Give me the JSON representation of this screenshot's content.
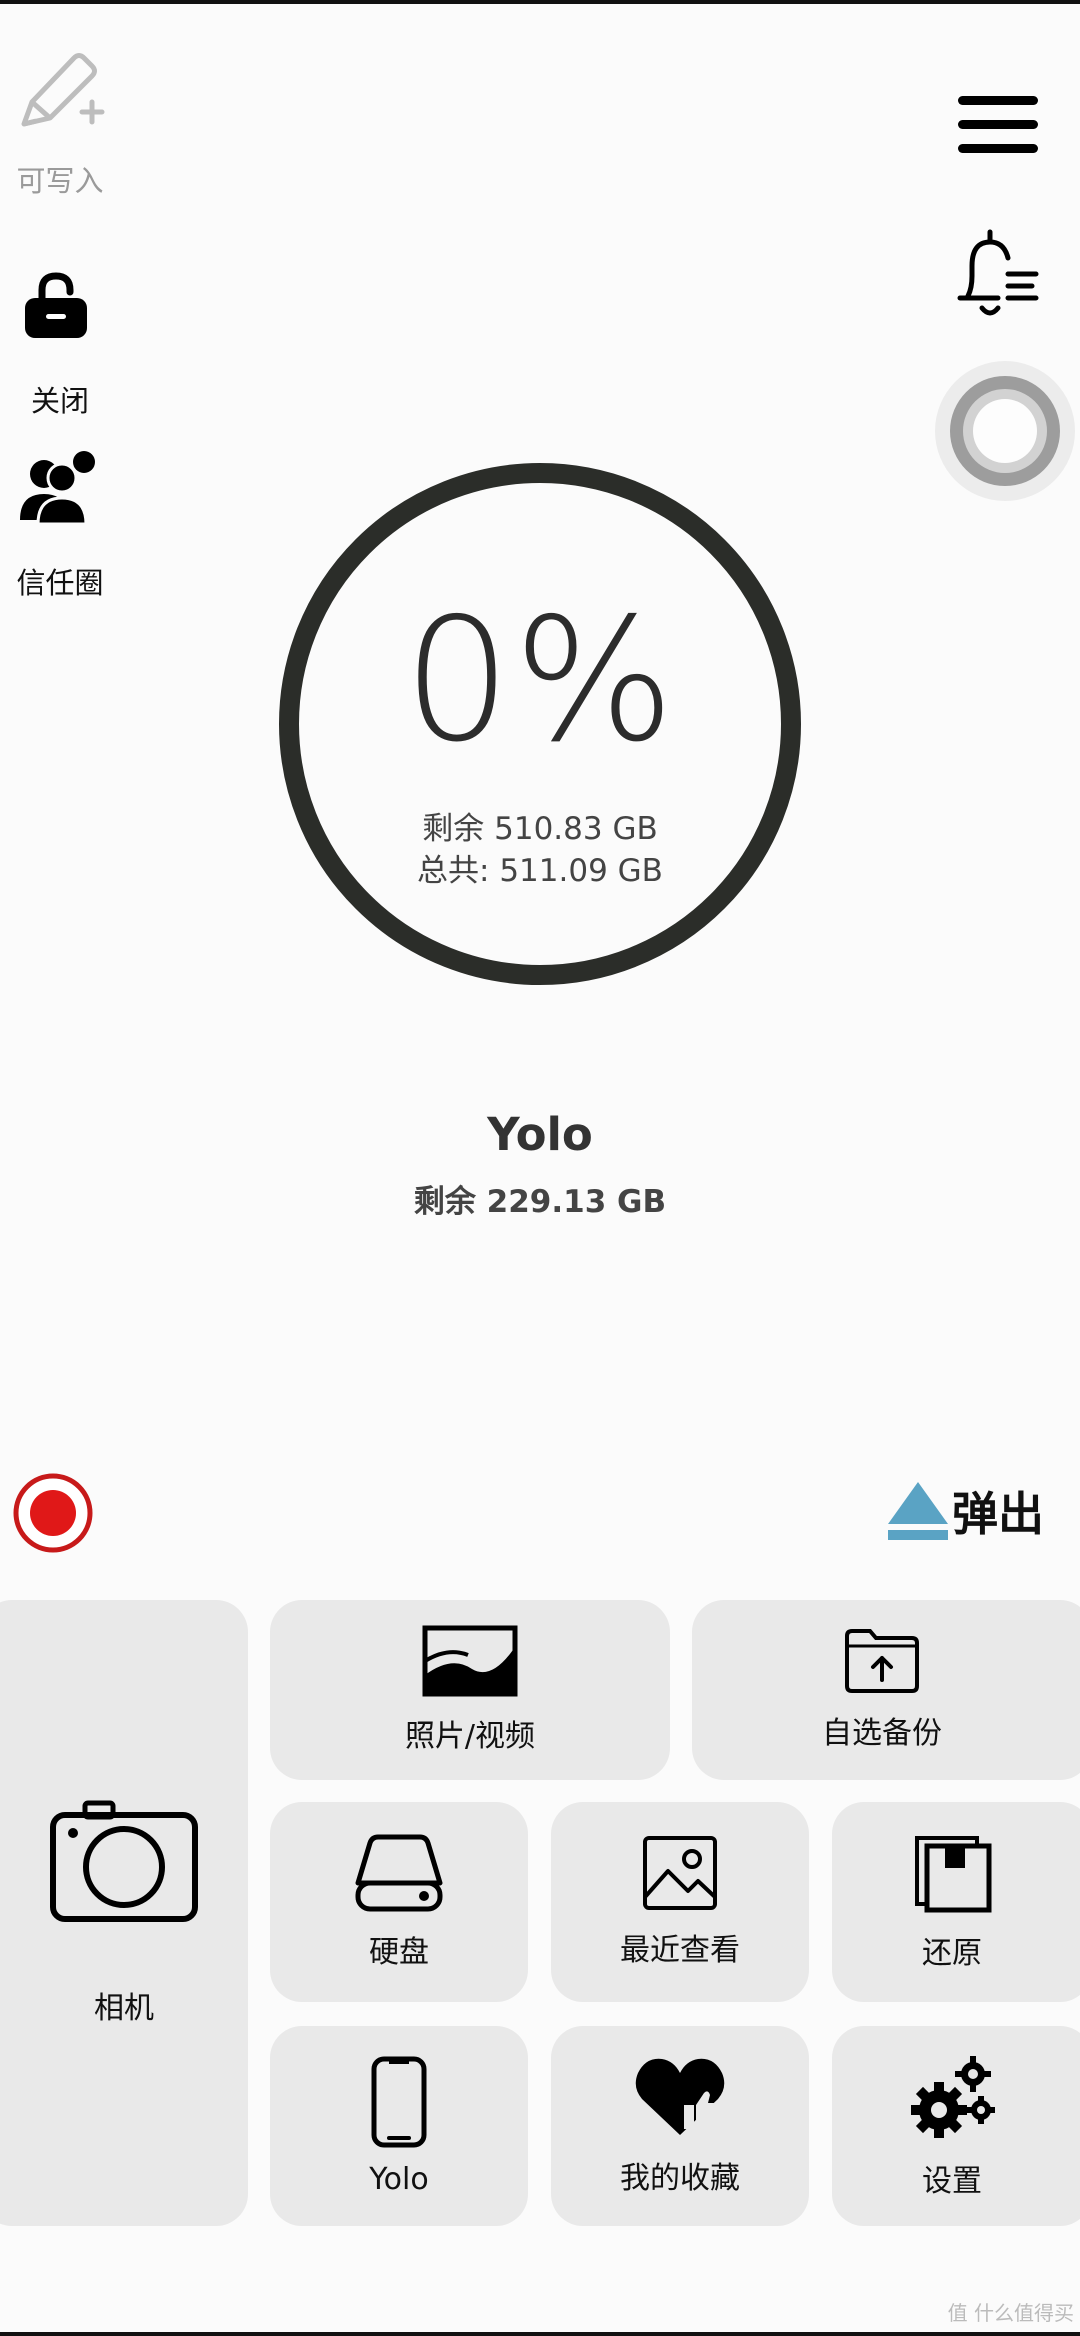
{
  "side": {
    "write_label": "可写入",
    "lock_label": "关闭",
    "trust_label": "信任圈"
  },
  "storage": {
    "percent": "0%",
    "remaining": "剩余 510.83 GB",
    "total": "总共: 511.09 GB"
  },
  "device": {
    "name": "Yolo",
    "remaining": "剩余 229.13 GB"
  },
  "eject_label": "弹出",
  "tiles": {
    "camera": "相机",
    "photos": "照片/视频",
    "custom_backup": "自选备份",
    "disk": "硬盘",
    "recent": "最近查看",
    "restore": "还原",
    "phone": "Yolo",
    "favorites": "我的收藏",
    "settings": "设置"
  },
  "watermark": "值 什么值得买",
  "colors": {
    "accent_blue": "#5aa3c4",
    "record_red": "#e01818",
    "ring": "#2b2d29"
  }
}
